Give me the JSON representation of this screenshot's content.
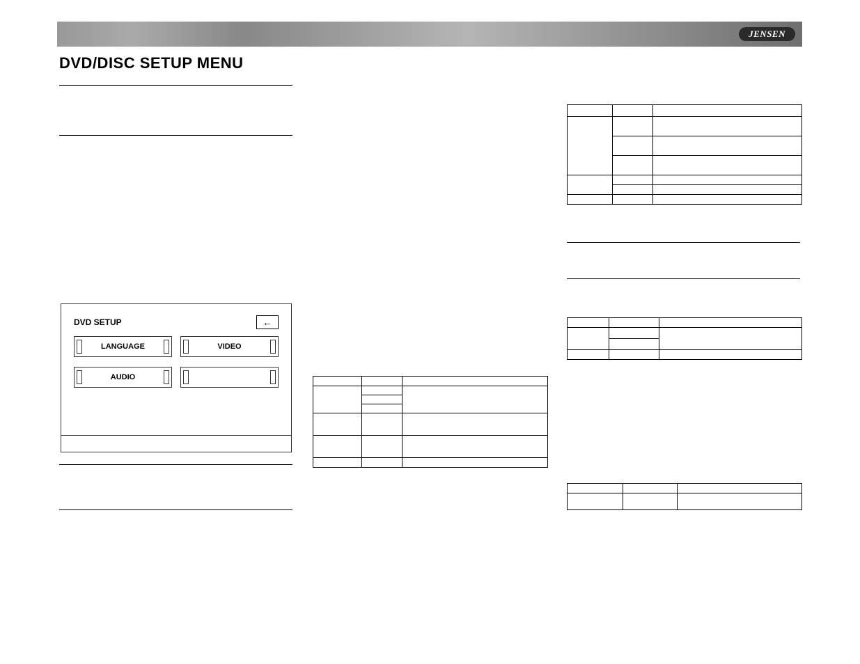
{
  "brand": "JENSEN",
  "page_title": "DVD/DISC SETUP MENU",
  "dvd_panel": {
    "title": "DVD SETUP",
    "back_glyph": "←",
    "buttons": [
      "LANGUAGE",
      "VIDEO",
      "AUDIO",
      ""
    ]
  },
  "tables": {
    "top_right": {
      "header": [
        "",
        "",
        ""
      ],
      "rows": [
        [
          "",
          "",
          ""
        ],
        [
          "",
          "",
          ""
        ],
        [
          "",
          "",
          ""
        ],
        [
          "",
          "",
          ""
        ],
        [
          "",
          "",
          ""
        ],
        [
          "",
          "",
          ""
        ]
      ]
    },
    "middle": {
      "header": [
        "",
        "",
        ""
      ],
      "rows": [
        [
          "",
          "",
          ""
        ],
        [
          "",
          "",
          ""
        ],
        [
          "",
          "",
          ""
        ],
        [
          "",
          "",
          ""
        ],
        [
          "",
          "",
          ""
        ],
        [
          "",
          "",
          ""
        ]
      ]
    },
    "middle_right": {
      "header": [
        "",
        "",
        ""
      ],
      "rows": [
        [
          "",
          "",
          ""
        ],
        [
          "",
          "",
          ""
        ],
        [
          "",
          "",
          ""
        ]
      ]
    },
    "bottom_right": {
      "header": [
        "",
        "",
        ""
      ],
      "rows": [
        [
          "",
          "",
          ""
        ]
      ]
    }
  }
}
